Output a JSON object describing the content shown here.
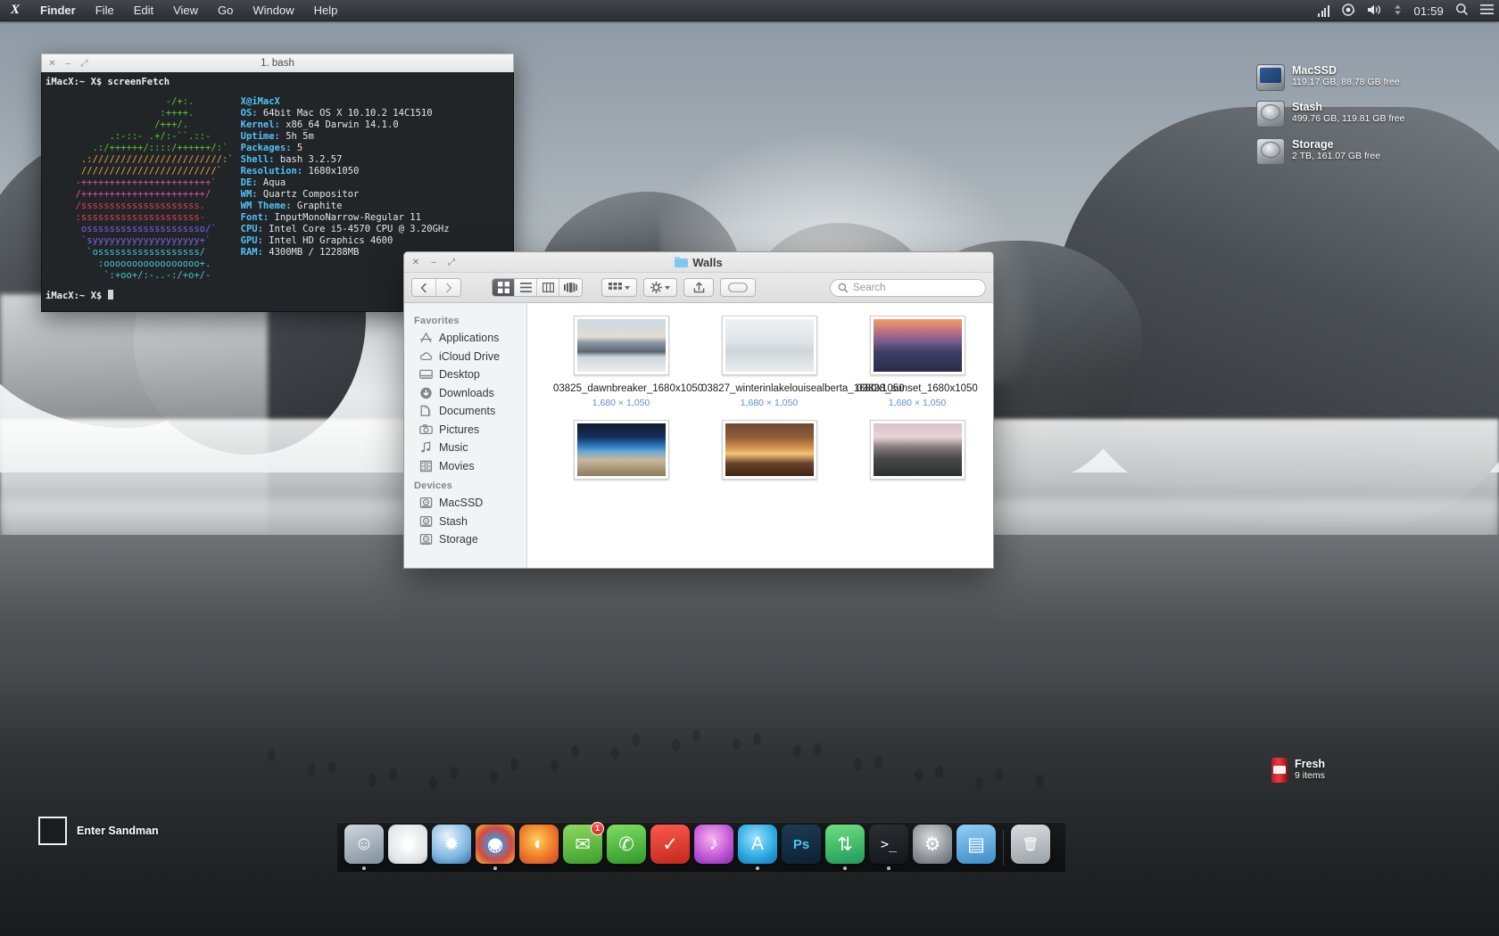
{
  "menubar": {
    "apple_logo": "X",
    "items": [
      {
        "label": "Finder",
        "active": true
      },
      {
        "label": "File",
        "active": false
      },
      {
        "label": "Edit",
        "active": false
      },
      {
        "label": "View",
        "active": false
      },
      {
        "label": "Go",
        "active": false
      },
      {
        "label": "Window",
        "active": false
      },
      {
        "label": "Help",
        "active": false
      }
    ],
    "status_icons": [
      "wifi-signal-icon",
      "airplay-icon",
      "volume-icon",
      "updown-arrows-icon"
    ],
    "clock": "01:59",
    "right_icons": [
      "search-icon",
      "notification-list-icon"
    ]
  },
  "terminal": {
    "window_buttons": [
      "close-button",
      "minimize-button",
      "zoom-button"
    ],
    "title": "1. bash",
    "prompt_line": "iMacX:~ X$ screenFetch",
    "last_prompt": "iMacX:~ X$ ",
    "ascii_art": [
      {
        "color": "#59c631",
        "text": "                     -/+:."
      },
      {
        "color": "#59c631",
        "text": "                    :++++."
      },
      {
        "color": "#59c631",
        "text": "                   /+++/."
      },
      {
        "color": "#59c631",
        "text": "           .:-::- .+/:-``.::-"
      },
      {
        "color": "#59c631",
        "text": "        .:/++++++/::::/++++++/:`"
      },
      {
        "color": "#e8a33d",
        "text": "      .:///////////////////////:`"
      },
      {
        "color": "#e8a33d",
        "text": "      ////////////////////////`"
      },
      {
        "color": "#e0519f",
        "text": "     -+++++++++++++++++++++++`"
      },
      {
        "color": "#e0519f",
        "text": "     /++++++++++++++++++++++/"
      },
      {
        "color": "#e0404b",
        "text": "     /sssssssssssssssssssss."
      },
      {
        "color": "#e0404b",
        "text": "     :sssssssssssssssssssss-"
      },
      {
        "color": "#7b61e8",
        "text": "      osssssssssssssssssssso/`"
      },
      {
        "color": "#7b61e8",
        "text": "      `syyyyyyyyyyyyyyyyyyy+`"
      },
      {
        "color": "#3ec6d8",
        "text": "       `ossssssssssssssssss/"
      },
      {
        "color": "#3ec6d8",
        "text": "         :ooooooooooooooooo+."
      },
      {
        "color": "#3ec6d8",
        "text": "          `:+oo+/:-..-:/+o+/-"
      }
    ],
    "info": [
      {
        "key": "X@iMacX",
        "value": ""
      },
      {
        "key": "OS:",
        "value": " 64bit Mac OS X 10.10.2 14C1510"
      },
      {
        "key": "Kernel:",
        "value": " x86_64 Darwin 14.1.0"
      },
      {
        "key": "Uptime:",
        "value": " 5h 5m"
      },
      {
        "key": "Packages:",
        "value": " 5"
      },
      {
        "key": "Shell:",
        "value": " bash 3.2.57"
      },
      {
        "key": "Resolution:",
        "value": " 1680x1050"
      },
      {
        "key": "DE:",
        "value": " Aqua"
      },
      {
        "key": "WM:",
        "value": " Quartz Compositor"
      },
      {
        "key": "WM Theme:",
        "value": " Graphite"
      },
      {
        "key": "Font:",
        "value": " InputMonoNarrow-Regular 11"
      },
      {
        "key": "CPU:",
        "value": " Intel Core i5-4570 CPU @ 3.20GHz"
      },
      {
        "key": "GPU:",
        "value": " Intel HD Graphics 4600"
      },
      {
        "key": "RAM:",
        "value": " 4300MB / 12288MB"
      }
    ]
  },
  "finder": {
    "window_buttons": [
      "close-button",
      "minimize-button",
      "zoom-button"
    ],
    "title": "Walls",
    "toolbar": {
      "back_label": "‹",
      "forward_label": "›",
      "view_modes": [
        "icon-view",
        "list-view",
        "column-view",
        "coverflow-view"
      ],
      "active_view": 0,
      "arrange_label": "arrange-icon",
      "action_label": "gear-icon",
      "share_label": "share-icon",
      "tag_label": "tag-icon"
    },
    "search": {
      "placeholder": "Search",
      "value": ""
    },
    "sidebar": {
      "sections": [
        {
          "title": "Favorites",
          "items": [
            {
              "label": "Applications",
              "icon": "applications-icon"
            },
            {
              "label": "iCloud Drive",
              "icon": "cloud-icon"
            },
            {
              "label": "Desktop",
              "icon": "desktop-icon"
            },
            {
              "label": "Downloads",
              "icon": "download-icon"
            },
            {
              "label": "Documents",
              "icon": "documents-icon"
            },
            {
              "label": "Pictures",
              "icon": "camera-icon"
            },
            {
              "label": "Music",
              "icon": "music-note-icon"
            },
            {
              "label": "Movies",
              "icon": "film-strip-icon"
            }
          ]
        },
        {
          "title": "Devices",
          "items": [
            {
              "label": "MacSSD",
              "icon": "hard-drive-icon"
            },
            {
              "label": "Stash",
              "icon": "hard-drive-icon"
            },
            {
              "label": "Storage",
              "icon": "hard-drive-icon"
            }
          ]
        }
      ]
    },
    "files": [
      {
        "name": "03825_dawnbreaker_1680x1050",
        "dimensions": "1,680 × 1,050",
        "thumb": "snow-mountain-dawn"
      },
      {
        "name": "03827_winterinlakelouisealberta_1680x1050",
        "dimensions": "1,680 × 1,050",
        "thumb": "winter-lake-louise"
      },
      {
        "name": "03828_sunset_1680x1050",
        "dimensions": "1,680 × 1,050",
        "thumb": "sunset-sea-stacks"
      },
      {
        "name": "",
        "dimensions": "",
        "thumb": "night-beach-blue"
      },
      {
        "name": "",
        "dimensions": "",
        "thumb": "mesa-arch-canyon"
      },
      {
        "name": "",
        "dimensions": "",
        "thumb": "cliff-pink-sky"
      }
    ]
  },
  "desktop": {
    "drives": [
      {
        "name": "MacSSD",
        "info": "119.17 GB, 88.78 GB free",
        "icon": "macintosh-hd-icon"
      },
      {
        "name": "Stash",
        "info": "499.76 GB, 119.81 GB free",
        "icon": "hard-drive-icon"
      },
      {
        "name": "Storage",
        "info": "2 TB, 161.07 GB free",
        "icon": "hard-drive-icon"
      }
    ],
    "fresh": {
      "name": "Fresh",
      "info": "9 items",
      "icon": "soda-can-icon"
    },
    "sandman": {
      "label": "Enter Sandman",
      "icon": "black-square-icon"
    }
  },
  "dock": {
    "items": [
      {
        "name": "finder",
        "glyph": "☺",
        "bg": "linear-gradient(160deg,#cfd8de,#7d8e9c)",
        "running": true,
        "badge": ""
      },
      {
        "name": "dashboard-clock",
        "glyph": "◉",
        "bg": "radial-gradient(circle at 50% 45%,#ffffff,#e2e6e9 70%,#b6bcc0)",
        "running": false,
        "badge": ""
      },
      {
        "name": "safari",
        "glyph": "✹",
        "bg": "radial-gradient(circle at 40% 30%,#e8f3fb,#7fb6e0 60%,#2f6ea8)",
        "running": false,
        "badge": ""
      },
      {
        "name": "chrome",
        "glyph": "◍",
        "bg": "radial-gradient(circle at 50% 50%,#ffffff 20%,#4a90d9 21%,#d64a3f 60%,#f2c230)",
        "running": true,
        "badge": ""
      },
      {
        "name": "firefox",
        "glyph": "◐",
        "bg": "radial-gradient(circle at 45% 40%,#ffd25a,#ef7a2a 55%,#c9432a)",
        "running": false,
        "badge": ""
      },
      {
        "name": "messages",
        "glyph": "✉",
        "bg": "linear-gradient(170deg,#8fd861,#3aa02b)",
        "running": false,
        "badge": "1"
      },
      {
        "name": "facetime",
        "glyph": "✆",
        "bg": "linear-gradient(170deg,#7fdc62,#2f9a28)",
        "running": false,
        "badge": ""
      },
      {
        "name": "reminders",
        "glyph": "✓",
        "bg": "linear-gradient(170deg,#fb5a4c,#c3271d)",
        "running": false,
        "badge": ""
      },
      {
        "name": "itunes",
        "glyph": "♪",
        "bg": "radial-gradient(circle at 45% 35%,#fbb4ec,#c35bd8 55%,#7f2bb0)",
        "running": false,
        "badge": ""
      },
      {
        "name": "app-store",
        "glyph": "A",
        "bg": "radial-gradient(circle at 45% 35%,#9fe4ff,#29a8e0 60%,#1476b8)",
        "running": true,
        "badge": ""
      },
      {
        "name": "photoshop",
        "glyph": "Ps",
        "bg": "linear-gradient(170deg,#1d3a54,#0d2233)",
        "running": false,
        "badge": ""
      },
      {
        "name": "transmit",
        "glyph": "⇅",
        "bg": "linear-gradient(170deg,#6fe07f,#1f9a5a)",
        "running": true,
        "badge": ""
      },
      {
        "name": "terminal",
        "glyph": ">_",
        "bg": "linear-gradient(170deg,#2b2f33,#14161a)",
        "running": true,
        "badge": ""
      },
      {
        "name": "system-preferences",
        "glyph": "⚙",
        "bg": "radial-gradient(circle at 45% 35%,#d9dde1,#8c9298 60%,#5f656b)",
        "running": false,
        "badge": ""
      },
      {
        "name": "downloads-stack",
        "glyph": "▤",
        "bg": "linear-gradient(170deg,#8fd0f5,#3f8cc9)",
        "running": false,
        "badge": ""
      },
      {
        "name": "trash",
        "glyph": "🗑",
        "bg": "linear-gradient(170deg,#d8dde1,#9aa1a7)",
        "running": false,
        "badge": ""
      }
    ]
  }
}
